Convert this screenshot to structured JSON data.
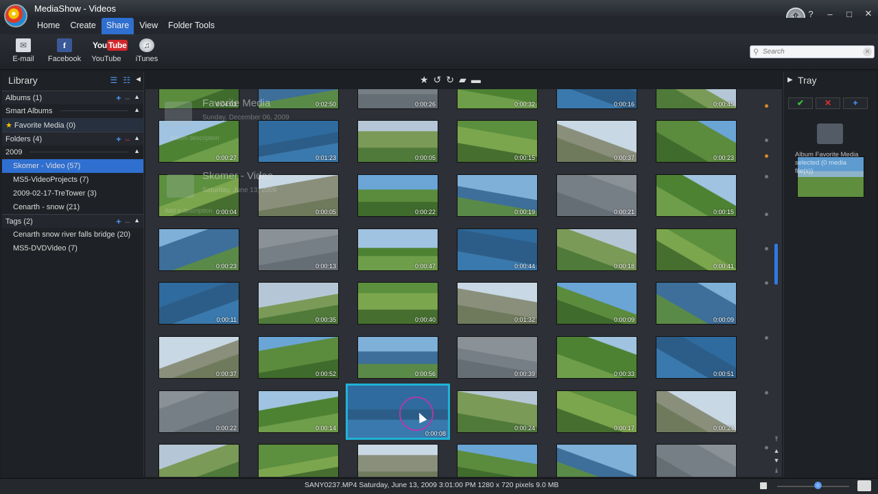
{
  "window": {
    "title": "MediaShow - Videos",
    "help": "?",
    "minimize": "–",
    "maximize": "□",
    "close": "✕",
    "upgrade_glyph": "⇧"
  },
  "menu": {
    "tabs": [
      "Home",
      "Create",
      "Share",
      "View",
      "Folder Tools"
    ],
    "active_tab": "Share"
  },
  "ribbon": {
    "email": "E-mail",
    "facebook": "Facebook",
    "youtube": "YouTube",
    "itunes": "iTunes",
    "youtube_logo_you": "You",
    "youtube_logo_tube": "Tube",
    "facebook_glyph": "f",
    "email_glyph": "✉",
    "itunes_glyph": "♫"
  },
  "search": {
    "placeholder": "Search",
    "icon": "⚲",
    "clear": "✕"
  },
  "library": {
    "title": "Library",
    "albums": "Albums (1)",
    "smart_albums": "Smart Albums",
    "favorite_media": "Favorite Media (0)",
    "folders": "Folders (4)",
    "year": "2009",
    "folder_items": [
      "Skomer - Video (57)",
      "MS5-VideoProjects (7)",
      "2009-02-17-TreTower (3)",
      "Cenarth - snow (21)"
    ],
    "selected_folder": "Skomer - Video (57)",
    "tags": "Tags (2)",
    "tag_items": [
      "Cenarth snow river falls bridge (20)",
      "MS5-DVDVideo (7)"
    ]
  },
  "grid": {
    "overlay_groups": [
      {
        "title": "Favorite Media",
        "date": "Sunday, December 06, 2009",
        "desc": "Album description"
      },
      {
        "title": "Skomer - Video",
        "date": "Saturday, June 13, 2009",
        "desc": "Add a description"
      }
    ],
    "durations": [
      [
        "0:04:03",
        "0:02:50",
        "0:00:26",
        "0:00:32",
        "0:00:16",
        "0:00:45"
      ],
      [
        "0:00:27",
        "0:01:23",
        "0:00:05",
        "0:00:15",
        "0:00:37",
        "0:00:23"
      ],
      [
        "0:00:04",
        "0:00:05",
        "0:00:22",
        "0:00:19",
        "0:00:21",
        "0:00:15"
      ],
      [
        "0:00:23",
        "0:00:13",
        "0:00:47",
        "0:00:44",
        "0:00:18",
        "0:00:41"
      ],
      [
        "0:00:11",
        "0:00:35",
        "0:00:40",
        "0:01:32",
        "0:00:09",
        "0:00:09"
      ],
      [
        "0:00:37",
        "0:00:52",
        "0:00:56",
        "0:00:39",
        "0:00:33",
        "0:00:51"
      ],
      [
        "0:00:22",
        "0:00:14",
        "0:00:08",
        "0:00:24",
        "0:00:17",
        "0:00:24"
      ],
      [
        "",
        "",
        "",
        "",
        "",
        ""
      ]
    ],
    "selected": [
      6,
      2
    ]
  },
  "tray": {
    "title": "Tray",
    "album_text": "Album Favorite Media selected (0 media file(s))"
  },
  "status": {
    "text": "SANY0237.MP4  Saturday, June 13, 2009 3:01:00 PM  1280 x 720 pixels  9.0 MB"
  },
  "colors": {
    "accent": "#2f6fd0",
    "selection": "#1fb4d8"
  }
}
